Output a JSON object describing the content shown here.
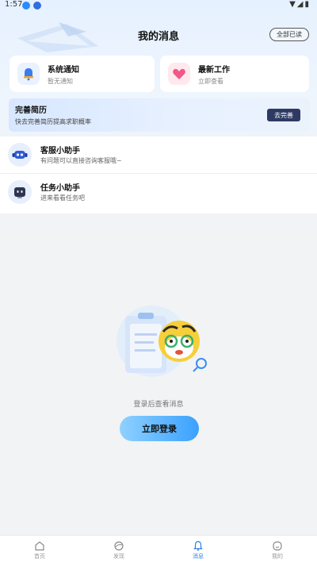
{
  "status_bar": {
    "time": "1:57",
    "icons": "wifi-signal-battery"
  },
  "header": {
    "title": "我的消息",
    "read_all": "全部已读"
  },
  "cards": [
    {
      "title": "系统通知",
      "subtitle": "暂无通知",
      "icon": "bell-icon"
    },
    {
      "title": "最新工作",
      "subtitle": "立即查看",
      "icon": "heart-icon"
    }
  ],
  "resume_banner": {
    "title": "完善简历",
    "subtitle": "快去完善简历提高求职概率",
    "button": "去完善"
  },
  "messages": [
    {
      "name": "客服小助手",
      "desc": "有问题可以直接咨询客服哦~",
      "icon": "robot-headset-icon"
    },
    {
      "name": "任务小助手",
      "desc": "进来看看任务吧",
      "icon": "robot-icon"
    }
  ],
  "empty_state": {
    "text": "登录后查看消息",
    "button": "立即登录"
  },
  "bottom_nav": [
    {
      "label": "首页",
      "icon": "home-icon",
      "active": false
    },
    {
      "label": "发现",
      "icon": "discover-icon",
      "active": false
    },
    {
      "label": "消息",
      "icon": "message-icon",
      "active": true
    },
    {
      "label": "我的",
      "icon": "profile-icon",
      "active": false
    }
  ],
  "colors": {
    "accent": "#2d7fe8",
    "banner_button": "#2e3a63",
    "login_start": "#8fd1ff",
    "login_end": "#3aa1ff"
  }
}
